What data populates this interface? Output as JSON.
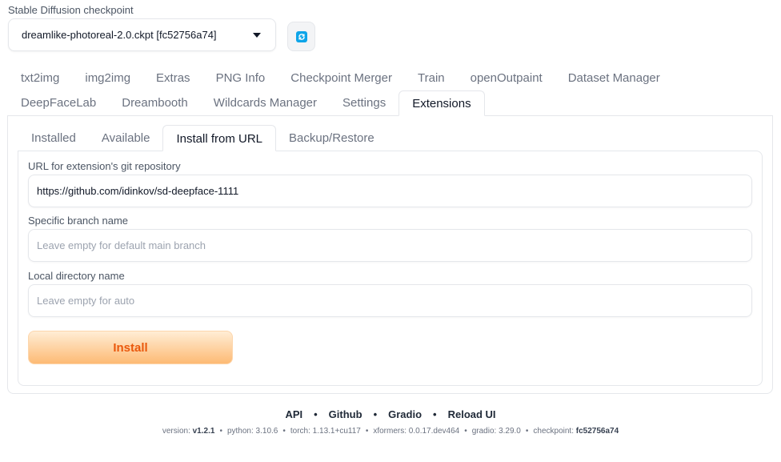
{
  "checkpoint": {
    "label": "Stable Diffusion checkpoint",
    "value": "dreamlike-photoreal-2.0.ckpt [fc52756a74]",
    "refresh_icon": "refresh-icon"
  },
  "tabs_row1": [
    "txt2img",
    "img2img",
    "Extras",
    "PNG Info",
    "Checkpoint Merger",
    "Train",
    "openOutpaint",
    "Dataset Manager"
  ],
  "tabs_row2": [
    "DeepFaceLab",
    "Dreambooth",
    "Wildcards Manager",
    "Settings",
    "Extensions"
  ],
  "active_tab": "Extensions",
  "subtabs": [
    "Installed",
    "Available",
    "Install from URL",
    "Backup/Restore"
  ],
  "active_subtab": "Install from URL",
  "form": {
    "url_label": "URL for extension's git repository",
    "url_value": "https://github.com/idinkov/sd-deepface-1111",
    "branch_label": "Specific branch name",
    "branch_placeholder": "Leave empty for default main branch",
    "dir_label": "Local directory name",
    "dir_placeholder": "Leave empty for auto",
    "install_label": "Install"
  },
  "footer": {
    "links": [
      "API",
      "Github",
      "Gradio",
      "Reload UI"
    ],
    "versions": [
      {
        "label": "version:",
        "value": "v1.2.1",
        "bold": true
      },
      {
        "label": "python:",
        "value": "3.10.6"
      },
      {
        "label": "torch:",
        "value": "1.13.1+cu117"
      },
      {
        "label": "xformers:",
        "value": "0.0.17.dev464"
      },
      {
        "label": "gradio:",
        "value": "3.29.0"
      },
      {
        "label": "checkpoint:",
        "value": "fc52756a74",
        "bold": true
      }
    ]
  },
  "colors": {
    "accent_orange": "#ea580c",
    "refresh_blue": "#0ea5e9",
    "border": "#e5e7eb"
  }
}
